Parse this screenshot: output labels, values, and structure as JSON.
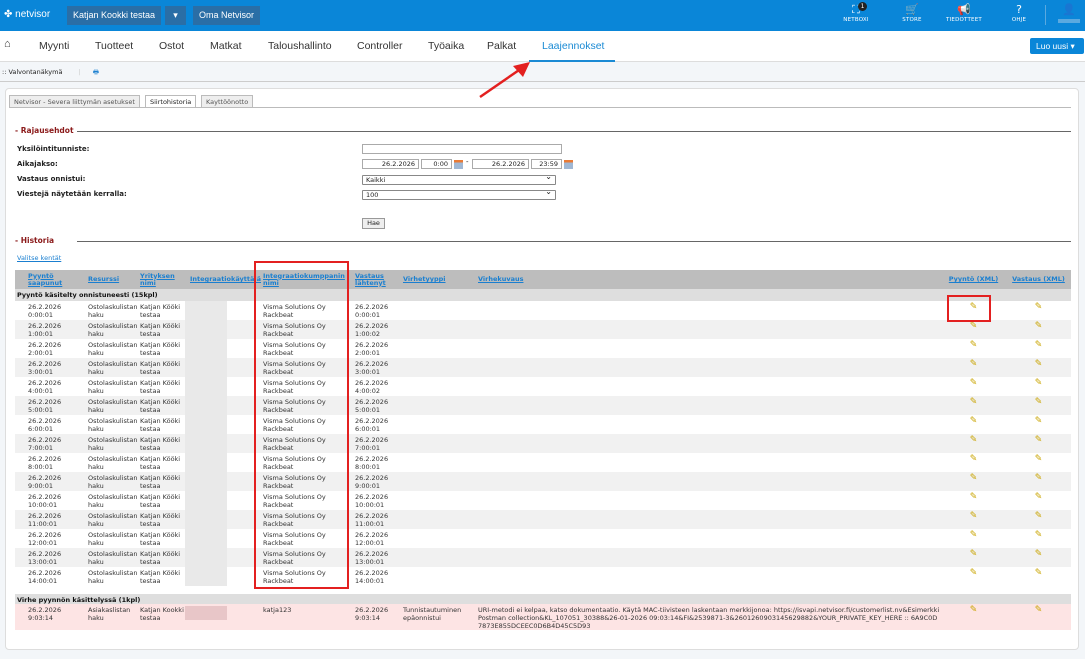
{
  "topbar": {
    "logo": "netvisor",
    "company": "Katjan Kookki testaa",
    "dropdown": "▾",
    "oma": "Oma Netvisor",
    "icons": [
      {
        "label": "NETBOXI",
        "badge": "1",
        "glyph": "⛶"
      },
      {
        "label": "STORE",
        "glyph": "🛒"
      },
      {
        "label": "TIEDOTTEET",
        "glyph": "📢"
      },
      {
        "label": "OHJE",
        "glyph": "?"
      }
    ],
    "user_glyph": "👤"
  },
  "nav": {
    "items": [
      "Myynti",
      "Tuotteet",
      "Ostot",
      "Matkat",
      "Taloushallinto",
      "Controller",
      "Työaika",
      "Palkat",
      "Laajennokset"
    ],
    "active": "Laajennokset",
    "luo_uusi": "Luo uusi ▾"
  },
  "breadcrumb": {
    "text": ":: Valvontanäkymä",
    "print": "🖶"
  },
  "tabs": [
    "Netvisor - Severa liittymän asetukset",
    "Siirtohistoria",
    "Kayttöönotto"
  ],
  "filters": {
    "title": "Rajausehdot",
    "id_label": "Yksilöintitunniste:",
    "id_value": "",
    "period_label": "Aikajakso:",
    "start_date": "26.2.2026",
    "start_time": "0:00",
    "sep": "-",
    "end_date": "26.2.2026",
    "end_time": "23:59",
    "response_label": "Vastaus onnistui:",
    "response_value": "Kaikki",
    "count_label": "Viestejä näytetään kerralla:",
    "count_value": "100",
    "search": "Hae"
  },
  "history": {
    "title": "Historia",
    "choose_fields": "Valitse kentät",
    "columns": [
      "Pyyntö saapunut",
      "Resurssi",
      "Yrityksen nimi",
      "Integraatiokäyttäjä",
      "Integraatiokumppanin nimi",
      "Vastaus lähtenyt",
      "Virhetyyppi",
      "Virhekuvaus",
      "Pyyntö (XML)",
      "Vastaus (XML)"
    ],
    "success_group": "Pyyntö käsitelty onnistuneesti (15kpl)",
    "rows": [
      {
        "date": "26.2.2026",
        "time": "0:00:01",
        "res": "Ostolaskulistan haku",
        "company": "Katjan Kööki testaa",
        "partner": "Visma Solutions Oy Rackbeat",
        "resp_date": "26.2.2026",
        "resp_time": "0:00:01"
      },
      {
        "date": "26.2.2026",
        "time": "1:00:01",
        "res": "Ostolaskulistan haku",
        "company": "Katjan Kööki testaa",
        "partner": "Visma Solutions Oy Rackbeat",
        "resp_date": "26.2.2026",
        "resp_time": "1:00:02"
      },
      {
        "date": "26.2.2026",
        "time": "2:00:01",
        "res": "Ostolaskulistan haku",
        "company": "Katjan Kööki testaa",
        "partner": "Visma Solutions Oy Rackbeat",
        "resp_date": "26.2.2026",
        "resp_time": "2:00:01"
      },
      {
        "date": "26.2.2026",
        "time": "3:00:01",
        "res": "Ostolaskulistan haku",
        "company": "Katjan Kööki testaa",
        "partner": "Visma Solutions Oy Rackbeat",
        "resp_date": "26.2.2026",
        "resp_time": "3:00:01"
      },
      {
        "date": "26.2.2026",
        "time": "4:00:01",
        "res": "Ostolaskulistan haku",
        "company": "Katjan Kööki testaa",
        "partner": "Visma Solutions Oy Rackbeat",
        "resp_date": "26.2.2026",
        "resp_time": "4:00:02"
      },
      {
        "date": "26.2.2026",
        "time": "5:00:01",
        "res": "Ostolaskulistan haku",
        "company": "Katjan Kööki testaa",
        "partner": "Visma Solutions Oy Rackbeat",
        "resp_date": "26.2.2026",
        "resp_time": "5:00:01"
      },
      {
        "date": "26.2.2026",
        "time": "6:00:01",
        "res": "Ostolaskulistan haku",
        "company": "Katjan Kööki testaa",
        "partner": "Visma Solutions Oy Rackbeat",
        "resp_date": "26.2.2026",
        "resp_time": "6:00:01"
      },
      {
        "date": "26.2.2026",
        "time": "7:00:01",
        "res": "Ostolaskulistan haku",
        "company": "Katjan Kööki testaa",
        "partner": "Visma Solutions Oy Rackbeat",
        "resp_date": "26.2.2026",
        "resp_time": "7:00:01"
      },
      {
        "date": "26.2.2026",
        "time": "8:00:01",
        "res": "Ostolaskulistan haku",
        "company": "Katjan Kööki testaa",
        "partner": "Visma Solutions Oy Rackbeat",
        "resp_date": "26.2.2026",
        "resp_time": "8:00:01"
      },
      {
        "date": "26.2.2026",
        "time": "9:00:01",
        "res": "Ostolaskulistan haku",
        "company": "Katjan Kööki testaa",
        "partner": "Visma Solutions Oy Rackbeat",
        "resp_date": "26.2.2026",
        "resp_time": "9:00:01"
      },
      {
        "date": "26.2.2026",
        "time": "10:00:01",
        "res": "Ostolaskulistan haku",
        "company": "Katjan Kööki testaa",
        "partner": "Visma Solutions Oy Rackbeat",
        "resp_date": "26.2.2026",
        "resp_time": "10:00:01"
      },
      {
        "date": "26.2.2026",
        "time": "11:00:01",
        "res": "Ostolaskulistan haku",
        "company": "Katjan Kööki testaa",
        "partner": "Visma Solutions Oy Rackbeat",
        "resp_date": "26.2.2026",
        "resp_time": "11:00:01"
      },
      {
        "date": "26.2.2026",
        "time": "12:00:01",
        "res": "Ostolaskulistan haku",
        "company": "Katjan Kööki testaa",
        "partner": "Visma Solutions Oy Rackbeat",
        "resp_date": "26.2.2026",
        "resp_time": "12:00:01"
      },
      {
        "date": "26.2.2026",
        "time": "13:00:01",
        "res": "Ostolaskulistan haku",
        "company": "Katjan Kööki testaa",
        "partner": "Visma Solutions Oy Rackbeat",
        "resp_date": "26.2.2026",
        "resp_time": "13:00:01"
      },
      {
        "date": "26.2.2026",
        "time": "14:00:01",
        "res": "Ostolaskulistan haku",
        "company": "Katjan Kööki testaa",
        "partner": "Visma Solutions Oy Rackbeat",
        "resp_date": "26.2.2026",
        "resp_time": "14:00:01"
      }
    ],
    "error_group": "Virhe pyynnön käsittelyssä (1kpl)",
    "error_row": {
      "date": "26.2.2026",
      "time": "9:03:14",
      "res": "Asiakaslistan haku",
      "company": "Katjan Kookki testaa",
      "partner": "katja123",
      "resp_date": "26.2.2026",
      "resp_time": "9:03:14",
      "error_type": "Tunnistautuminen epäonnistui",
      "error_desc": "URI-metodi ei kelpaa, katso dokumentaatio. Käytä MAC-tiivisteen laskentaan merkkijonoa: https://isvapi.netvisor.fi/customerlist.nv&Esimerkki Postman collection&KL_107051_30388&26-01-2026 09:03:14&FI&2539871-3&2601260903145629882&YOUR_PRIVATE_KEY_HERE :: 6A9C0D7873E855DCEEC0D6B4D45C5D93"
    },
    "xml_icon": "✎"
  },
  "colors": {
    "brand": "#0a86d8",
    "annotation": "#e32020",
    "error_row": "#fde4e4"
  }
}
